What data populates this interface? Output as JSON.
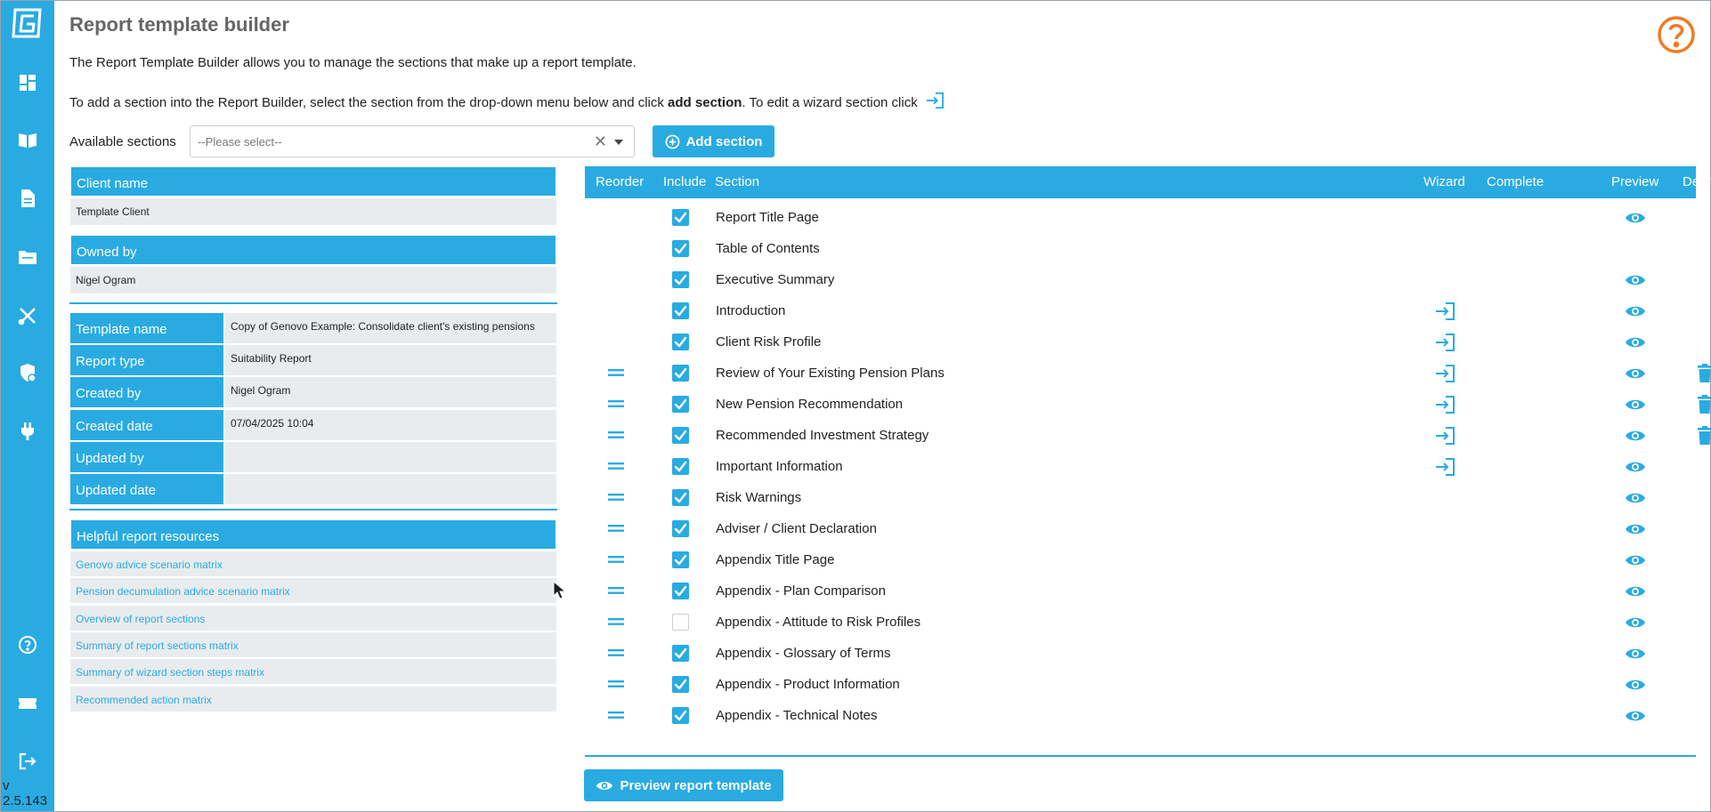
{
  "app": {
    "version": "v 2.5.143"
  },
  "sidebar": {
    "items": [
      {
        "icon": "dashboard-icon"
      },
      {
        "icon": "book-icon"
      },
      {
        "icon": "document-icon"
      },
      {
        "icon": "folder-icon"
      },
      {
        "icon": "tools-icon"
      },
      {
        "icon": "shield-icon"
      },
      {
        "icon": "plug-icon"
      },
      {
        "icon": "help-icon"
      },
      {
        "icon": "ticket-icon"
      },
      {
        "icon": "logout-icon"
      }
    ]
  },
  "header": {
    "title": "Report template builder"
  },
  "intro": {
    "line1": "The Report Template Builder allows you to manage the sections that make up a report template.",
    "line2_part1": "To add a section into the Report Builder, select the section from the drop-down menu below and click ",
    "line2_bold": "add section",
    "line2_part2": ". To edit a wizard section click"
  },
  "toolbar": {
    "available_label": "Available sections",
    "select_placeholder": "--Please select--",
    "add_label": "Add section",
    "preview_label": "Preview report template"
  },
  "client": {
    "client_name_label": "Client name",
    "client_name": "Template Client",
    "owned_by_label": "Owned by",
    "owned_by": "Nigel Ogram"
  },
  "template": {
    "rows": [
      {
        "key": "Template name",
        "value": "Copy of Genovo Example: Consolidate client's existing pensions"
      },
      {
        "key": "Report type",
        "value": "Suitability Report"
      },
      {
        "key": "Created by",
        "value": "Nigel Ogram"
      },
      {
        "key": "Created date",
        "value": "07/04/2025 10:04"
      },
      {
        "key": "Updated by",
        "value": ""
      },
      {
        "key": "Updated date",
        "value": ""
      }
    ]
  },
  "resources": {
    "header": "Helpful report resources",
    "items": [
      "Genovo advice scenario matrix",
      "Pension decumulation advice scenario matrix",
      "Overview of report sections",
      "Summary of report sections matrix",
      "Summary of wizard section steps matrix",
      "Recommended action matrix"
    ]
  },
  "sections_table": {
    "columns": [
      "Reorder",
      "Include",
      "Section",
      "Wizard",
      "Complete",
      "Preview",
      "Delete"
    ],
    "rows": [
      {
        "name": "Report Title Page",
        "reorder": false,
        "include": true,
        "wizard": false,
        "preview": true,
        "delete": false
      },
      {
        "name": "Table of Contents",
        "reorder": false,
        "include": true,
        "wizard": false,
        "preview": false,
        "delete": false
      },
      {
        "name": "Executive Summary",
        "reorder": false,
        "include": true,
        "wizard": false,
        "preview": true,
        "delete": false
      },
      {
        "name": "Introduction",
        "reorder": false,
        "include": true,
        "wizard": true,
        "preview": true,
        "delete": false
      },
      {
        "name": "Client Risk Profile",
        "reorder": false,
        "include": true,
        "wizard": true,
        "preview": true,
        "delete": false
      },
      {
        "name": "Review of Your Existing Pension Plans",
        "reorder": true,
        "include": true,
        "wizard": true,
        "preview": true,
        "delete": true
      },
      {
        "name": "New Pension Recommendation",
        "reorder": true,
        "include": true,
        "wizard": true,
        "preview": true,
        "delete": true
      },
      {
        "name": "Recommended Investment Strategy",
        "reorder": true,
        "include": true,
        "wizard": true,
        "preview": true,
        "delete": true
      },
      {
        "name": "Important Information",
        "reorder": true,
        "include": true,
        "wizard": true,
        "preview": true,
        "delete": false
      },
      {
        "name": "Risk Warnings",
        "reorder": true,
        "include": true,
        "wizard": false,
        "preview": true,
        "delete": false
      },
      {
        "name": "Adviser / Client Declaration",
        "reorder": true,
        "include": true,
        "wizard": false,
        "preview": true,
        "delete": false
      },
      {
        "name": "Appendix Title Page",
        "reorder": true,
        "include": true,
        "wizard": false,
        "preview": true,
        "delete": false
      },
      {
        "name": "Appendix - Plan Comparison",
        "reorder": true,
        "include": true,
        "wizard": false,
        "preview": true,
        "delete": false
      },
      {
        "name": "Appendix - Attitude to Risk Profiles",
        "reorder": true,
        "include": false,
        "wizard": false,
        "preview": true,
        "delete": false
      },
      {
        "name": "Appendix - Glossary of Terms",
        "reorder": true,
        "include": true,
        "wizard": false,
        "preview": true,
        "delete": false
      },
      {
        "name": "Appendix - Product Information",
        "reorder": true,
        "include": true,
        "wizard": false,
        "preview": true,
        "delete": false
      },
      {
        "name": "Appendix - Technical Notes",
        "reorder": true,
        "include": true,
        "wizard": false,
        "preview": true,
        "delete": false
      }
    ]
  },
  "colors": {
    "accent": "#29abe2",
    "help_orange": "#f07a24",
    "panel_grey": "#e9ecee"
  }
}
